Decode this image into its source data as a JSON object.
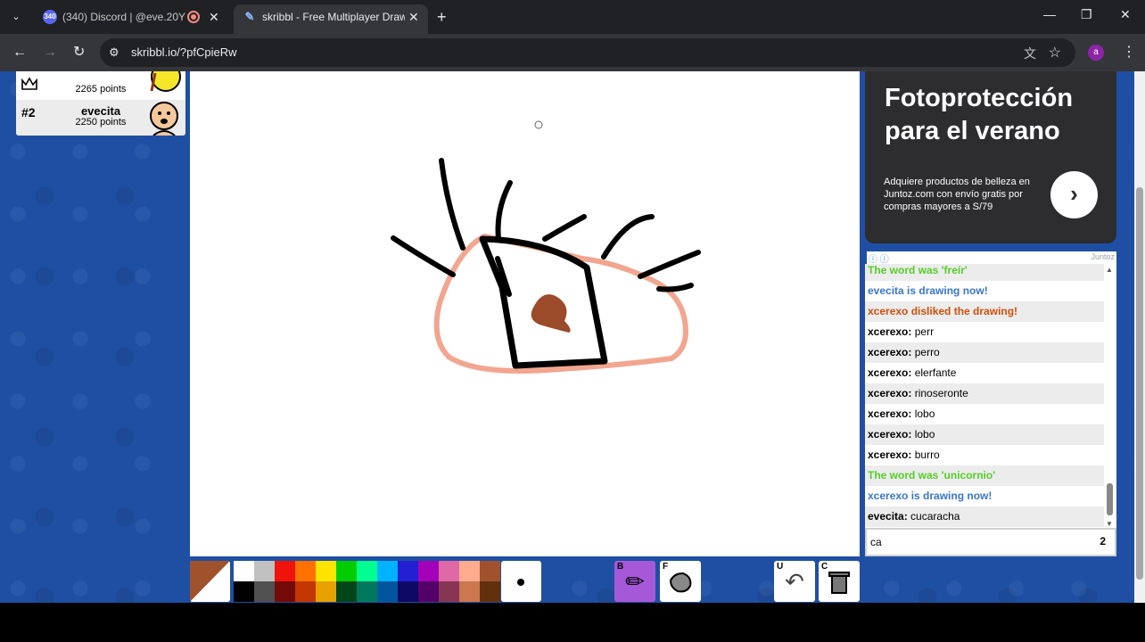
{
  "browser": {
    "tabs": [
      {
        "title": "(340) Discord | @eve.20Y",
        "badge": "340",
        "active": false
      },
      {
        "title": "skribbl - Free Multiplayer Drawi",
        "active": true
      }
    ],
    "url": "skribbl.io/?pfCpieRw",
    "profile_initial": "a"
  },
  "players": [
    {
      "rank": "",
      "name": "",
      "points": "2265 points",
      "crown": true
    },
    {
      "rank": "#2",
      "name": "evecita",
      "points": "2250 points",
      "crown": false
    }
  ],
  "ad": {
    "headline": "Fotoprotección para el verano",
    "body": "Adquiere productos de belleza en Juntoz.com con envío gratis por compras mayores a S/79",
    "brand": "Juntoz",
    "arrow": "›"
  },
  "chat": {
    "messages": [
      {
        "type": "green",
        "text": "The word was 'freír'"
      },
      {
        "type": "blue",
        "text": "evecita is drawing now!"
      },
      {
        "type": "red",
        "text": "xcerexo disliked the drawing!"
      },
      {
        "type": "user",
        "user": "xcerexo:",
        "text": "perr"
      },
      {
        "type": "user",
        "user": "xcerexo:",
        "text": "perro"
      },
      {
        "type": "user",
        "user": "xcerexo:",
        "text": "elerfante"
      },
      {
        "type": "user",
        "user": "xcerexo:",
        "text": "rinoseronte"
      },
      {
        "type": "user",
        "user": "xcerexo:",
        "text": "lobo"
      },
      {
        "type": "user",
        "user": "xcerexo:",
        "text": "lobo"
      },
      {
        "type": "user",
        "user": "xcerexo:",
        "text": "burro"
      },
      {
        "type": "green",
        "text": "The word was 'unicornio'"
      },
      {
        "type": "blue",
        "text": "xcerexo is drawing now!"
      },
      {
        "type": "user",
        "user": "evecita:",
        "text": "cucaracha"
      }
    ],
    "input_value": "ca",
    "char_count": "2"
  },
  "toolbar": {
    "current_color": "#a0522d",
    "palette_top": [
      "#ffffff",
      "#c1c1c1",
      "#ef130b",
      "#ff7100",
      "#ffe400",
      "#00cc00",
      "#00ff91",
      "#00b2ff",
      "#231fd3",
      "#a300ba",
      "#df69a7",
      "#ffac8e",
      "#a0522d"
    ],
    "palette_bottom": [
      "#000000",
      "#505050",
      "#740b07",
      "#c23800",
      "#e8a200",
      "#004619",
      "#00785d",
      "#00569e",
      "#0e0865",
      "#550069",
      "#873554",
      "#cc774d",
      "#63300d"
    ],
    "tools": [
      {
        "key": "B",
        "name": "pencil",
        "selected": true
      },
      {
        "key": "F",
        "name": "fill",
        "selected": false
      },
      {
        "key": "U",
        "name": "undo",
        "selected": false
      },
      {
        "key": "C",
        "name": "clear",
        "selected": false
      }
    ]
  }
}
